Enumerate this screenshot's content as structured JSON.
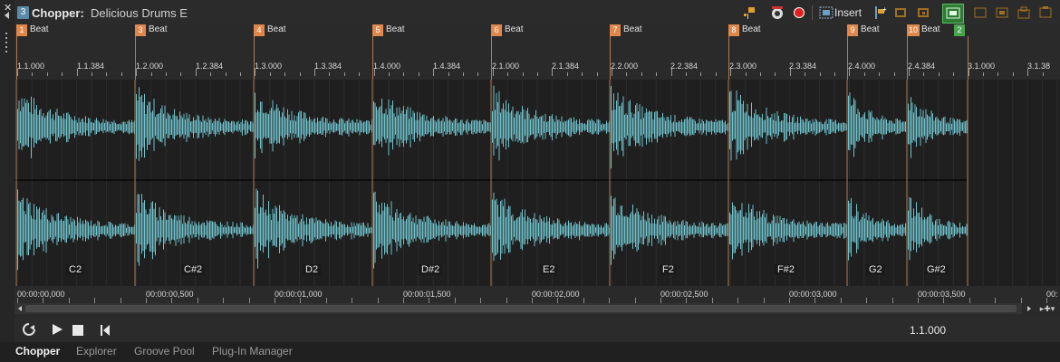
{
  "window": {
    "track_number": "3",
    "title_prefix": "Chopper:",
    "title_name": "Delicious Drums E"
  },
  "toolbar": {
    "insert_label": "Insert"
  },
  "markers": [
    {
      "num": "1",
      "label": "Beat"
    },
    {
      "num": "3",
      "label": "Beat"
    },
    {
      "num": "4",
      "label": "Beat"
    },
    {
      "num": "5",
      "label": "Beat"
    },
    {
      "num": "6",
      "label": "Beat"
    },
    {
      "num": "7",
      "label": "Beat"
    },
    {
      "num": "8",
      "label": "Beat"
    },
    {
      "num": "9",
      "label": "Beat"
    },
    {
      "num": "10",
      "label": "Beat"
    },
    {
      "num": "2",
      "label": ""
    }
  ],
  "beat_ruler": [
    "1.1.000",
    "1.1.384",
    "1.2.000",
    "1.2.384",
    "1.3.000",
    "1.3.384",
    "1.4.000",
    "1.4.384",
    "2.1.000",
    "2.1.384",
    "2.2.000",
    "2.2.384",
    "2.3.000",
    "2.3.384",
    "2.4.000",
    "2.4.384",
    "3.1.000",
    "3.1.38"
  ],
  "notes": [
    "C2",
    "C#2",
    "D2",
    "D#2",
    "E2",
    "F2",
    "F#2",
    "G2",
    "G#2"
  ],
  "time_ruler": [
    "00:00:00,000",
    "00:00:00,500",
    "00:00:01,000",
    "00:00:01,500",
    "00:00:02,000",
    "00:00:02,500",
    "00:00:03,000",
    "00:00:03,500",
    "00:"
  ],
  "transport": {
    "position": "1.1.000"
  },
  "tabs": [
    "Chopper",
    "Explorer",
    "Groove Pool",
    "Plug-In Manager"
  ],
  "colors": {
    "waveform": "#6fc3cc",
    "marker": "#e0884c",
    "end_marker": "#4aa44f",
    "record": "#e02020"
  }
}
